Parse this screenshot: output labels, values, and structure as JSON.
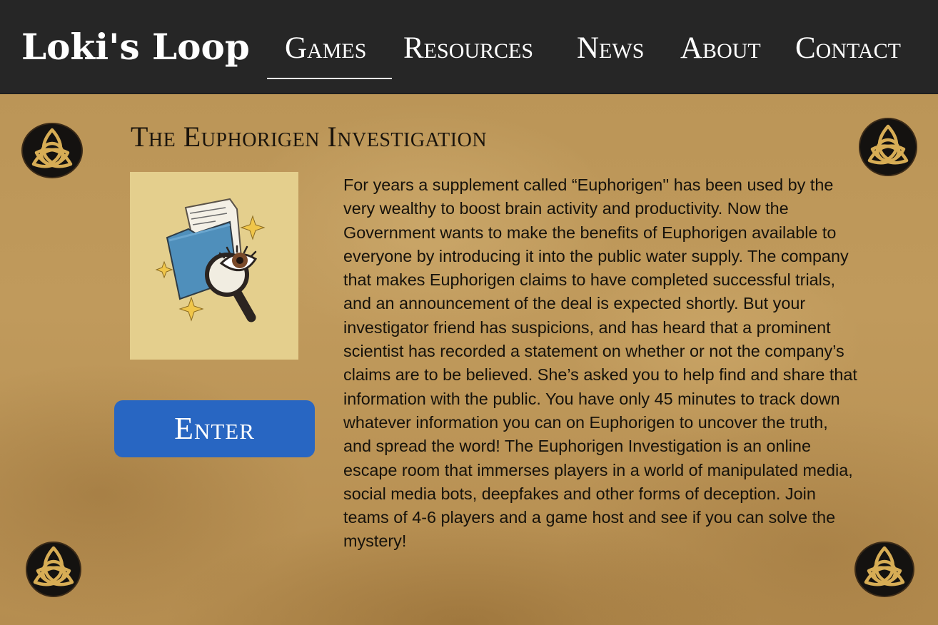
{
  "header": {
    "logo": "Loki's Loop",
    "nav": [
      {
        "label": "Games",
        "active": true
      },
      {
        "label": "Resources",
        "active": false
      },
      {
        "label": "News",
        "active": false
      },
      {
        "label": "About",
        "active": false
      },
      {
        "label": "Contact",
        "active": false
      }
    ]
  },
  "main": {
    "title": "The Euphorigen Investigation",
    "thumbnail_icon": "folder-magnifier-eye-icon",
    "enter_label": "Enter",
    "description": "For years a supplement called “Euphorigen'' has been used by the very wealthy to boost brain activity and productivity. Now the Government wants to make the benefits of Euphorigen available to everyone by introducing it into the public water supply. The company that makes Euphorigen claims to have completed successful trials, and an announcement of the deal is expected shortly. But your investigator friend has suspicions, and has heard that a prominent scientist has recorded a statement on whether or not the company’s claims are to be believed. She’s asked you to help find and share that information with the public. You have only 45 minutes to track down whatever information you can on Euphorigen to uncover the truth, and spread the word! The Euphorigen Investigation is an online escape room that immerses players in a world of manipulated media, social media bots, deepfakes and other forms of deception. Join teams of 4-6 players and a game host and see if you can solve the mystery!"
  },
  "decor": {
    "corner_icon": "triquetra-knot-icon"
  },
  "colors": {
    "header_bg": "#262626",
    "parchment": "#bb9557",
    "button": "#2866c2",
    "thumbnail_bg": "#e4cf8d"
  }
}
